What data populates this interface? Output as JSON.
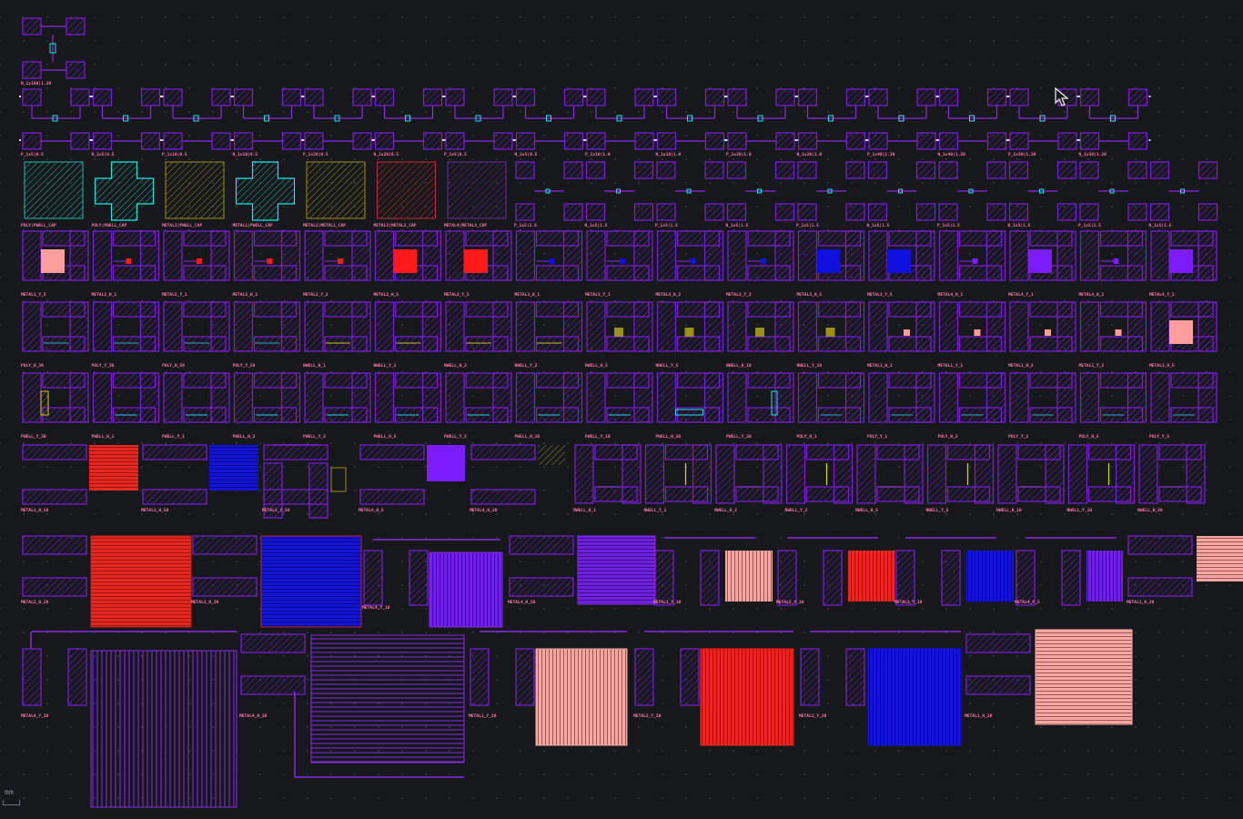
{
  "app": {
    "canvas_background": "#16181c",
    "scale_unit": "mm"
  },
  "colors": {
    "pad": "#7a1fd6",
    "pad_hatch": "#7a1fd6",
    "route": "#8a2be2",
    "label": "#ff7aa8",
    "metal1": "#ff9d9d",
    "metal2": "#ff1a1a",
    "metal3": "#1010e0",
    "metal4": "#7c1cff",
    "poly": "#22b8b8",
    "pwell": "#1ee6e6",
    "nwell": "#cfcf20",
    "diff": "#9a8e1c"
  },
  "rows": [
    {
      "name": "row-top",
      "labels": [
        "N_1x100|1.20"
      ]
    },
    {
      "name": "row-transistors",
      "labels": [
        "P_1x5|0.5",
        "N_1x5|0.5",
        "P_1x10|0.5",
        "N_1x10|0.5",
        "P_1x20|0.5",
        "N_1x20|0.5",
        "P_1x5|0.5",
        "N_1x5|0.5",
        "P_1x10|1.0",
        "N_1x10|1.0",
        "P_1x20|1.0",
        "N_1x20|1.0",
        "P_1x40|1.20",
        "N_1x40|1.20",
        "P_1x50|1.20",
        "N_1x50|1.20"
      ]
    },
    {
      "name": "row-caps",
      "labels": [
        "POLY|PWELL_CAP",
        "POLY|PWELL_CAP",
        "METAL1|PWELL_CAP",
        "METAL1|PWELL_CAP",
        "METAL2|METAL1_CAP",
        "METAL3|METAL2_CAP",
        "METAL4|METAL3_CAP",
        "P_1x5|1.5",
        "N_1x5|1.5",
        "P_1x5|1.5",
        "N_1x5|1.5",
        "P_1x5|1.5",
        "N_1x5|1.5",
        "P_1x5|1.5",
        "N_1x5|1.5",
        "P_1x5|1.5",
        "N_1x5|1.5"
      ]
    },
    {
      "name": "row-metal-res",
      "labels": [
        "METAL1_Y_5",
        "METAL2_H_1",
        "METAL2_Y_1",
        "METAL2_H_2",
        "METAL2_Y_2",
        "METAL2_H_5",
        "METAL2_Y_5",
        "METAL3_H_1",
        "METAL3_Y_1",
        "METAL3_H_2",
        "METAL3_Y_2",
        "METAL3_H_5",
        "METAL3_Y_5",
        "METAL4_H_1",
        "METAL4_Y_1",
        "METAL4_H_2",
        "METAL4_Y_2"
      ]
    },
    {
      "name": "row-poly-res",
      "labels": [
        "POLY_H_30",
        "POLY_Y_30",
        "POLY_H_50",
        "POLY_Y_50",
        "NWELL_H_1",
        "NWELL_Y_1",
        "NWELL_H_2",
        "NWELL_Y_2",
        "NWELL_H_5",
        "NWELL_Y_5",
        "NWELL_H_10",
        "NWELL_Y_10",
        "METAL1_H_1",
        "METAL1_Y_1",
        "METAL1_H_2",
        "METAL1_Y_2",
        "METAL1_H_5"
      ]
    },
    {
      "name": "row-pwell-res",
      "labels": [
        "PWELL_Y_30",
        "PWELL_H_1",
        "PWELL_Y_1",
        "PWELL_H_2",
        "PWELL_Y_2",
        "PWELL_H_5",
        "PWELL_Y_5",
        "PWELL_H_10",
        "PWELL_Y_10",
        "PWELL_H_20",
        "PWELL_Y_20",
        "POLY_H_1",
        "POLY_Y_1",
        "POLY_H_2",
        "POLY_Y_2",
        "POLY_H_5",
        "POLY_Y_5"
      ]
    },
    {
      "name": "row-mixed",
      "labels": [
        "METAL2_H_50",
        "METAL3_H_50",
        "METAL3_Y_50",
        "METAL4_H_5",
        "METAL4_H_20",
        "NWELL_H_1",
        "NWELL_Y_1",
        "NWELL_H_2",
        "NWELL_Y_2",
        "NWELL_H_5",
        "NWELL_Y_5",
        "NWELL_H_10",
        "NWELL_Y_10",
        "NWELL_H_20"
      ]
    },
    {
      "name": "row-long",
      "labels": [
        "METAL2_H_20",
        "METAL3_H_20",
        "METAL4_Y_10",
        "METAL4_H_50",
        "METAL1_Y_10",
        "METAL2_Y_10",
        "METAL3_Y_10",
        "METAL4_Y_5",
        "METAL1_H_20"
      ]
    },
    {
      "name": "row-bottom",
      "labels": [
        "METAL4_Y_20",
        "METAL4_H_20",
        "METAL1_Y_20",
        "METAL2_Y_20",
        "METAL3_Y_20",
        "METAL1_H_20"
      ]
    }
  ]
}
